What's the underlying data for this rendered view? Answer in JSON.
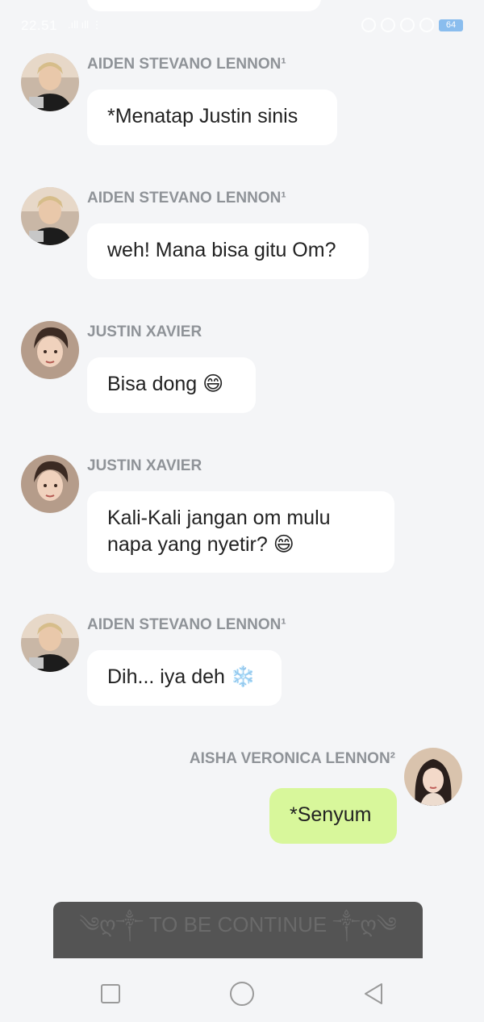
{
  "status_bar": {
    "time": "22.51",
    "signal": ".ıll ıll ⋮",
    "battery": "64"
  },
  "messages": [
    {
      "sender": "AIDEN STEVANO LENNON¹",
      "text": "*Menatap Justin sinis",
      "avatar": "aiden-avatar",
      "side": "left"
    },
    {
      "sender": "AIDEN STEVANO LENNON¹",
      "text": "weh! Mana bisa gitu Om?",
      "avatar": "aiden-avatar",
      "side": "left"
    },
    {
      "sender": "JUSTIN XAVIER",
      "text": "Bisa dong 😄",
      "avatar": "justin-avatar",
      "side": "left"
    },
    {
      "sender": "JUSTIN XAVIER",
      "text": "Kali-Kali jangan om mulu napa yang nyetir? 😄",
      "avatar": "justin-avatar",
      "side": "left"
    },
    {
      "sender": "AIDEN STEVANO LENNON¹",
      "text": "Dih... iya deh ❄️",
      "avatar": "aiden-avatar",
      "side": "left"
    },
    {
      "sender": "AISHA VERONICA LENNON²",
      "text": "*Senyum",
      "avatar": "aisha-avatar",
      "side": "right"
    }
  ],
  "banner": {
    "text": "༄ღ༒ TO BE CONTINUE ༒ღ༄"
  },
  "nav": {
    "recents": "square-icon",
    "home": "circle-icon",
    "back": "triangle-icon"
  },
  "colors": {
    "background": "#f4f5f7",
    "bubble_other": "#ffffff",
    "bubble_mine": "#d8f79b",
    "sender_name": "#8f9398",
    "banner_bg": "#545454"
  }
}
